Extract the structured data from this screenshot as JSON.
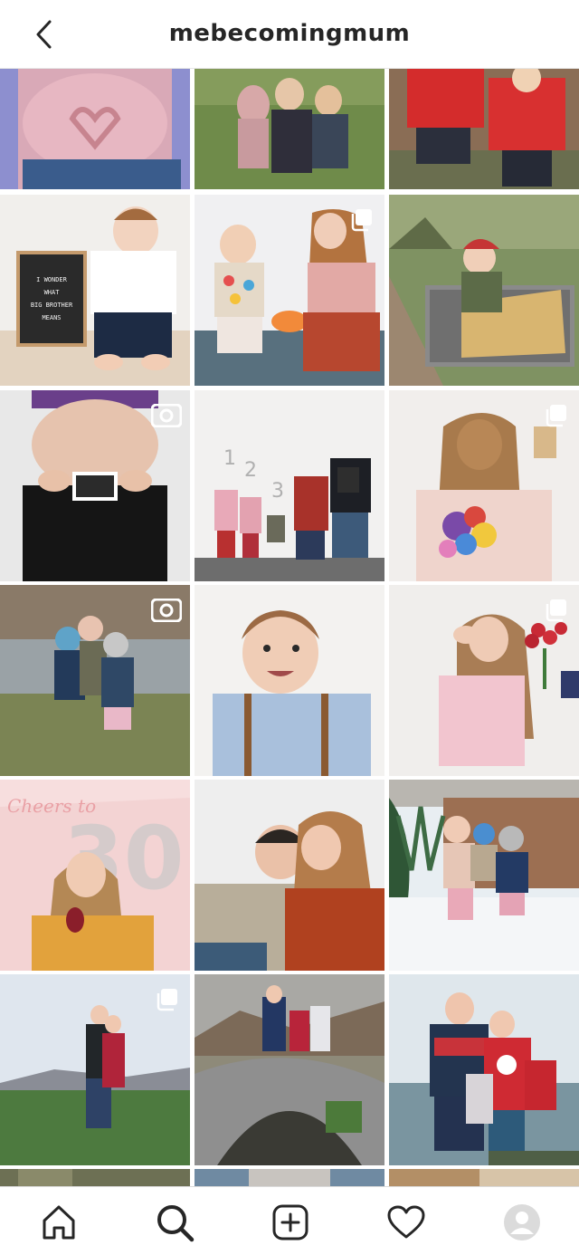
{
  "header": {
    "username": "mebecomingmum",
    "back_icon": "chevron-left-icon"
  },
  "grid": {
    "posts": [
      {
        "theme": "bump heart hands",
        "type": "photo"
      },
      {
        "theme": "family on grass",
        "type": "photo"
      },
      {
        "theme": "kids red jumpers",
        "type": "photo"
      },
      {
        "theme": "toddler letterboard",
        "type": "photo",
        "letterboard_text": [
          "I WONDER",
          "WHAT",
          "BIG BROTHER",
          "MEANS"
        ]
      },
      {
        "theme": "toddler and mum easter",
        "type": "carousel"
      },
      {
        "theme": "girl in wheelbarrow",
        "type": "photo"
      },
      {
        "theme": "bump with scan",
        "type": "video"
      },
      {
        "theme": "family numbers 1 2 3 4",
        "type": "photo"
      },
      {
        "theme": "mum with flowers",
        "type": "carousel"
      },
      {
        "theme": "kids by river",
        "type": "video"
      },
      {
        "theme": "toddler braces",
        "type": "photo"
      },
      {
        "theme": "mum roses",
        "type": "carousel"
      },
      {
        "theme": "cheers to 30",
        "type": "photo"
      },
      {
        "theme": "couple hug",
        "type": "photo"
      },
      {
        "theme": "kids in snow",
        "type": "photo"
      },
      {
        "theme": "couple in field",
        "type": "carousel"
      },
      {
        "theme": "family on bridge",
        "type": "photo"
      },
      {
        "theme": "family christmas jumpers",
        "type": "photo"
      }
    ]
  },
  "tabbar": {
    "items": [
      {
        "name": "home",
        "icon": "home-icon"
      },
      {
        "name": "search",
        "icon": "search-icon",
        "active": true
      },
      {
        "name": "new-post",
        "icon": "plus-square-icon"
      },
      {
        "name": "activity",
        "icon": "heart-icon"
      },
      {
        "name": "profile",
        "icon": "avatar-icon"
      }
    ]
  },
  "colors": {
    "text": "#262626",
    "divider": "#dbdbdb",
    "background": "#ffffff"
  }
}
